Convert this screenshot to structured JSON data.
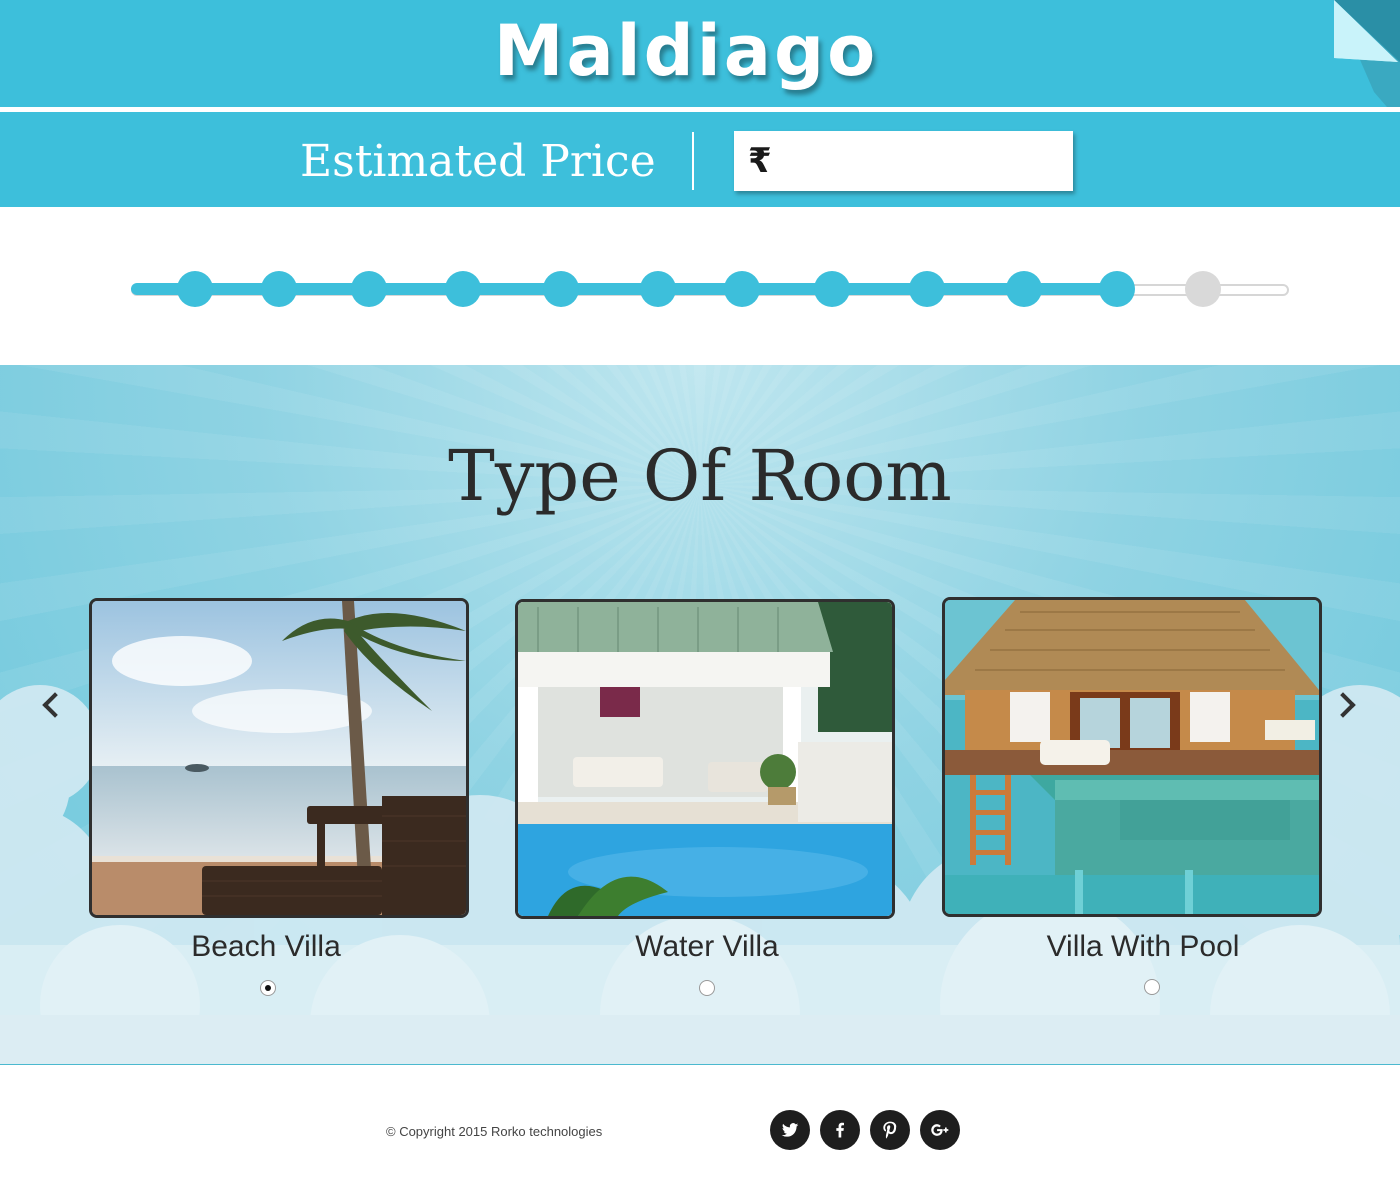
{
  "header": {
    "brand": "Maldiago",
    "price_label": "Estimated Price",
    "currency_symbol": "₹",
    "price_value": "",
    "accent_color": "#3dbfdb"
  },
  "progress": {
    "total_steps": 12,
    "completed_steps": 11
  },
  "rooms": {
    "title": "Type Of Room",
    "items": [
      {
        "label": "Beach Villa",
        "image": "beach-villa-photo",
        "selected": true
      },
      {
        "label": "Water Villa",
        "image": "water-villa-photo",
        "selected": false
      },
      {
        "label": "Villa With Pool",
        "image": "villa-with-pool-photo",
        "selected": false
      }
    ],
    "prev_icon": "chevron-left-icon",
    "next_icon": "chevron-right-icon"
  },
  "footer": {
    "copyright": "© Copyright 2015 Rorko technologies",
    "social": [
      "twitter-icon",
      "facebook-icon",
      "pinterest-icon",
      "google-plus-icon"
    ]
  }
}
